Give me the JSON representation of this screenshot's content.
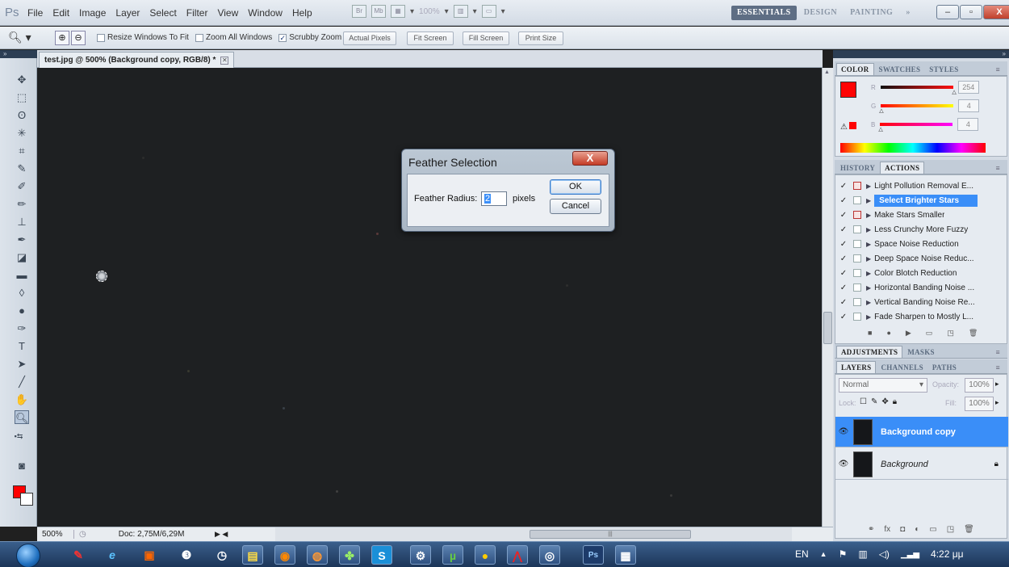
{
  "app": {
    "logo": "Ps"
  },
  "menu": [
    "File",
    "Edit",
    "Image",
    "Layer",
    "Select",
    "Filter",
    "View",
    "Window",
    "Help"
  ],
  "menubar_icons": [
    "Br",
    "Mb"
  ],
  "menubar_zoom": "100%",
  "workspaces": {
    "items": [
      "ESSENTIALS",
      "DESIGN",
      "PAINTING",
      "»"
    ],
    "active": "ESSENTIALS"
  },
  "window_controls": {
    "minimize": "–",
    "restore": "▫",
    "close": "X"
  },
  "options": {
    "checks": [
      {
        "label": "Resize Windows To Fit",
        "checked": false
      },
      {
        "label": "Zoom All Windows",
        "checked": false
      },
      {
        "label": "Scrubby Zoom",
        "checked": true
      }
    ],
    "buttons": [
      "Actual Pixels",
      "Fit Screen",
      "Fill Screen",
      "Print Size"
    ]
  },
  "document": {
    "tab_title": "test.jpg @ 500% (Background copy, RGB/8) *",
    "tab_close": "✕"
  },
  "status": {
    "zoom": "500%",
    "doc": "Doc: 2,75M/6,29M"
  },
  "color_panel": {
    "tabs": [
      "COLOR",
      "SWATCHES",
      "STYLES"
    ],
    "active": "COLOR",
    "r": {
      "label": "R",
      "value": "254"
    },
    "g": {
      "label": "G",
      "value": "4"
    },
    "b": {
      "label": "B",
      "value": "4"
    },
    "fg_color": "#fe0404"
  },
  "actions_panel": {
    "tabs": [
      "HISTORY",
      "ACTIONS"
    ],
    "active": "ACTIONS",
    "items": [
      {
        "name": "Light Pollution Removal E...",
        "modal": true,
        "selected": false
      },
      {
        "name": "Select Brighter Stars",
        "modal": false,
        "selected": true
      },
      {
        "name": "Make Stars Smaller",
        "modal": true,
        "selected": false
      },
      {
        "name": "Less Crunchy More Fuzzy",
        "modal": false,
        "selected": false
      },
      {
        "name": "Space Noise Reduction",
        "modal": false,
        "selected": false
      },
      {
        "name": "Deep Space Noise Reduc...",
        "modal": false,
        "selected": false
      },
      {
        "name": "Color Blotch Reduction",
        "modal": false,
        "selected": false
      },
      {
        "name": "Horizontal Banding Noise ...",
        "modal": false,
        "selected": false
      },
      {
        "name": "Vertical Banding Noise Re...",
        "modal": false,
        "selected": false
      },
      {
        "name": "Fade Sharpen to Mostly L...",
        "modal": false,
        "selected": false
      }
    ]
  },
  "adjust_tabs": {
    "tabs": [
      "ADJUSTMENTS",
      "MASKS"
    ],
    "active": "ADJUSTMENTS"
  },
  "layers_panel": {
    "tabs": [
      "LAYERS",
      "CHANNELS",
      "PATHS"
    ],
    "active": "LAYERS",
    "blend_mode": "Normal",
    "opacity_label": "Opacity:",
    "opacity": "100%",
    "lock_label": "Lock:",
    "fill_label": "Fill:",
    "fill": "100%",
    "layers": [
      {
        "name": "Background copy",
        "selected": true,
        "locked": false
      },
      {
        "name": "Background",
        "selected": false,
        "locked": true
      }
    ]
  },
  "dialog": {
    "title": "Feather Selection",
    "close": "X",
    "radius_label": "Feather Radius:",
    "radius_value": "2",
    "unit": "pixels",
    "ok": "OK",
    "cancel": "Cancel"
  },
  "taskbar": {
    "apps": [
      "pin",
      "ie",
      "media",
      "ie2",
      "clock",
      "folder",
      "firefox",
      "ubuntu",
      "puzzle",
      "skype",
      "settings",
      "utorrent",
      "chrome",
      "acrobat",
      "remote",
      "photoshop",
      "notepad"
    ],
    "photoshop_label": "Ps",
    "lang": "EN",
    "time": "4:22 μμ"
  }
}
